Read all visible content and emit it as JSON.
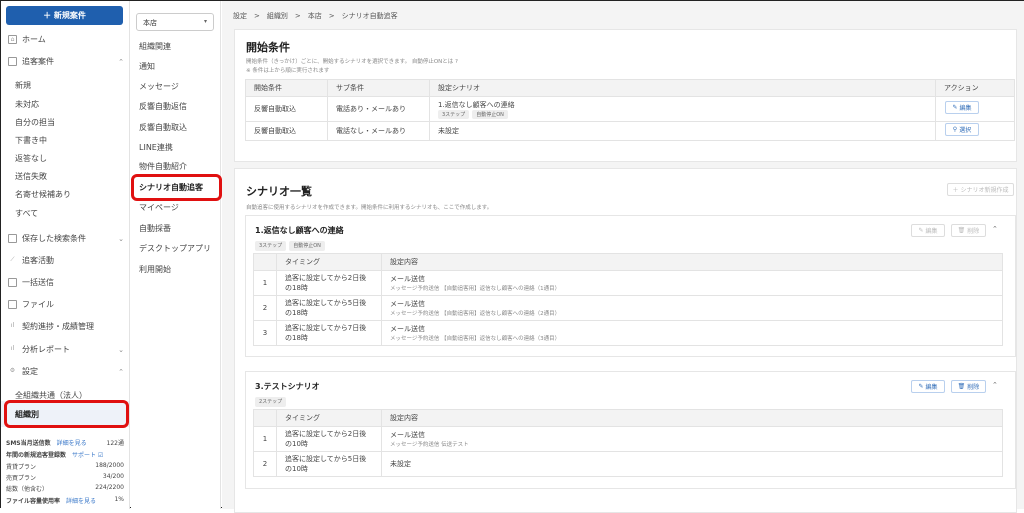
{
  "sidebar": {
    "new_button": "＋ 新規案件",
    "home": "ホーム",
    "tracking": "追客案件",
    "tracking_items": [
      "新規",
      "未対応",
      "自分の担当",
      "下書き中",
      "返答なし",
      "送信失敗",
      "名寄せ候補あり",
      "すべて"
    ],
    "saved_search": "保存した検索条件",
    "activity": "追客活動",
    "bulk_send": "一括送信",
    "files": "ファイル",
    "contracts": "契約進捗・成績管理",
    "reports": "分析レポート",
    "settings": "設定",
    "settings_items": [
      "全組織共通（法人）",
      "組織別"
    ],
    "stats": [
      {
        "label": "SMS当月送信数",
        "link": "詳細を見る",
        "value": "122通"
      },
      {
        "label": "年間の新規追客登録数",
        "link": "サポート ☑",
        "value": ""
      },
      {
        "label": "賃貸プラン",
        "link": "",
        "value": "188/2000"
      },
      {
        "label": "売買プラン",
        "link": "",
        "value": "34/200"
      },
      {
        "label": "総数（他含む）",
        "link": "",
        "value": "224/2200"
      },
      {
        "label": "ファイル容量使用率",
        "link": "詳細を見る",
        "value": "1%"
      }
    ]
  },
  "org_menu": {
    "store": "本店",
    "items": [
      "組織関連",
      "通知",
      "メッセージ",
      "反響自動返信",
      "反響自動取込",
      "LINE連携",
      "物件自動紹介",
      "シナリオ自動追客",
      "マイページ",
      "自動採番",
      "デスクトップアプリ",
      "利用開始"
    ]
  },
  "breadcrumb": "設定　>　組織別　>　本店　>　シナリオ自動追客",
  "start": {
    "title": "開始条件",
    "desc": "開始条件（きっかけ）ごとに、開始するシナリオを選択できます。 自動停止ONとは ?",
    "note": "※ 条件は上から順に実行されます",
    "headers": [
      "開始条件",
      "サブ条件",
      "設定シナリオ",
      "アクション"
    ],
    "rows": [
      {
        "cond": "反響自動取込",
        "sub": "電話あり・メールあり",
        "scenario": "1.返信なし顧客への連絡",
        "tags": [
          "3ステップ",
          "自動停止ON"
        ],
        "action": "編集"
      },
      {
        "cond": "反響自動取込",
        "sub": "電話なし・メールあり",
        "scenario": "未設定",
        "tags": [],
        "action": "選択"
      }
    ]
  },
  "list": {
    "title": "シナリオ一覧",
    "desc": "自動追客に使用するシナリオを作成できます。開始条件に利用するシナリオも、ここで作成します。",
    "new_button": "＋ シナリオ新規作成",
    "edit": "編集",
    "delete": "削除",
    "headers": [
      "",
      "タイミング",
      "設定内容"
    ],
    "scenarios": [
      {
        "title": "1.返信なし顧客への連絡",
        "tags": [
          "3ステップ",
          "自動停止ON"
        ],
        "steps": [
          {
            "n": "1",
            "timing": "追客に設定してから2日後の18時",
            "action": "メール送信",
            "detail": "メッセージ予約送信 【自動追客用】返信なし顧客への連絡（1通目）"
          },
          {
            "n": "2",
            "timing": "追客に設定してから5日後の18時",
            "action": "メール送信",
            "detail": "メッセージ予約送信 【自動追客用】返信なし顧客への連絡（2通目）"
          },
          {
            "n": "3",
            "timing": "追客に設定してから7日後の18時",
            "action": "メール送信",
            "detail": "メッセージ予約送信 【自動追客用】返信なし顧客への連絡（3通目）"
          }
        ]
      },
      {
        "title": "3.テストシナリオ",
        "tags": [
          "2ステップ"
        ],
        "steps": [
          {
            "n": "1",
            "timing": "追客に設定してから2日後の10時",
            "action": "メール送信",
            "detail": "メッセージ予約送信 伝送テスト"
          },
          {
            "n": "2",
            "timing": "追客に設定してから5日後の10時",
            "action": "未設定",
            "detail": ""
          }
        ]
      }
    ]
  }
}
